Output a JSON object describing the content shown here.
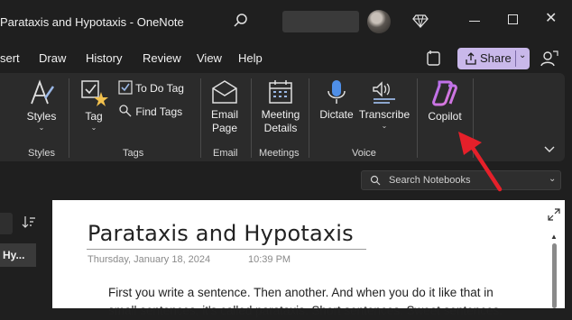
{
  "app": {
    "title": "Parataxis and Hypotaxis  -  OneNote"
  },
  "menu": {
    "items": [
      "sert",
      "Draw",
      "History",
      "Review",
      "View",
      "Help"
    ],
    "share_label": "Share"
  },
  "ribbon": {
    "styles_label": "Styles",
    "tag_label": "Tag",
    "todo_tag_label": "To Do Tag",
    "find_tags_label": "Find Tags",
    "email_page_label": [
      "Email",
      "Page"
    ],
    "meeting_details_label": [
      "Meeting",
      "Details"
    ],
    "dictate_label": "Dictate",
    "transcribe_label": "Transcribe",
    "copilot_label": "Copilot",
    "groups": {
      "styles": "Styles",
      "tags": "Tags",
      "email": "Email",
      "meetings": "Meetings",
      "voice": "Voice"
    }
  },
  "search": {
    "placeholder": "Search Notebooks"
  },
  "left_pane": {
    "page_item": "Hy..."
  },
  "page": {
    "title": "Parataxis and Hypotaxis",
    "date": "Thursday, January 18, 2024",
    "time": "10:39 PM",
    "body_line1": "First you write a sentence. Then another. And when you do it like that in",
    "body_line2": "small sentences, it's called parataxis. Short sentences. Sweet sentences."
  },
  "colors": {
    "share_bg": "#c9b8ea",
    "annotation_arrow": "#e5202a",
    "background": "#1f1f1f",
    "ribbon": "#2b2b2b"
  }
}
